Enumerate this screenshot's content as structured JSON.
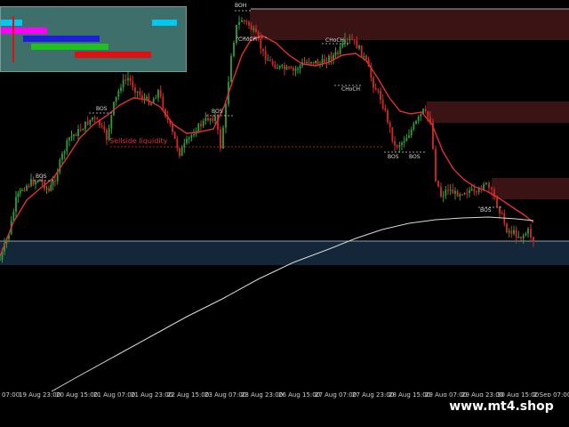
{
  "chart": {
    "labels": [
      {
        "text": "BOS"
      },
      {
        "text": "BOS"
      },
      {
        "text": "BOS"
      },
      {
        "text": "CHoCH"
      },
      {
        "text": "CHoCH"
      },
      {
        "text": "CHoCH"
      },
      {
        "text": "BOS"
      },
      {
        "text": "BOS"
      },
      {
        "text": "BOS"
      },
      {
        "text": "Sellside liquidity"
      }
    ],
    "top_label": "BOH",
    "colors": {
      "bull": "#2e9e3a",
      "bear": "#d42a22",
      "ma": "#e03030",
      "ma_slow": "#d8d8d8",
      "zone_bear": "#3a1414",
      "zone_bull": "#14263a",
      "panel_bg": "#3f6f6b"
    },
    "indicator_panel": {
      "bars": [
        {
          "color": "#00c8f0"
        },
        {
          "color": "#ff00ff"
        },
        {
          "color": "#1c20d8"
        },
        {
          "color": "#20c020"
        },
        {
          "color": "#e01010"
        },
        {
          "color": "#00c8f0"
        }
      ]
    }
  },
  "axis": {
    "ticks": [
      "07:00",
      "19 Aug 23:00",
      "20 Aug 15:00",
      "21 Aug 07:00",
      "21 Aug 23:00",
      "22 Aug 15:00",
      "23 Aug 07:00",
      "23 Aug 23:00",
      "26 Aug 15:00",
      "27 Aug 07:00",
      "27 Aug 23:00",
      "28 Aug 15:00",
      "29 Aug 07:00",
      "29 Aug 23:00",
      "30 Aug 15:00",
      "2 Sep 07:00"
    ]
  },
  "watermark": "www.mt4.shop"
}
